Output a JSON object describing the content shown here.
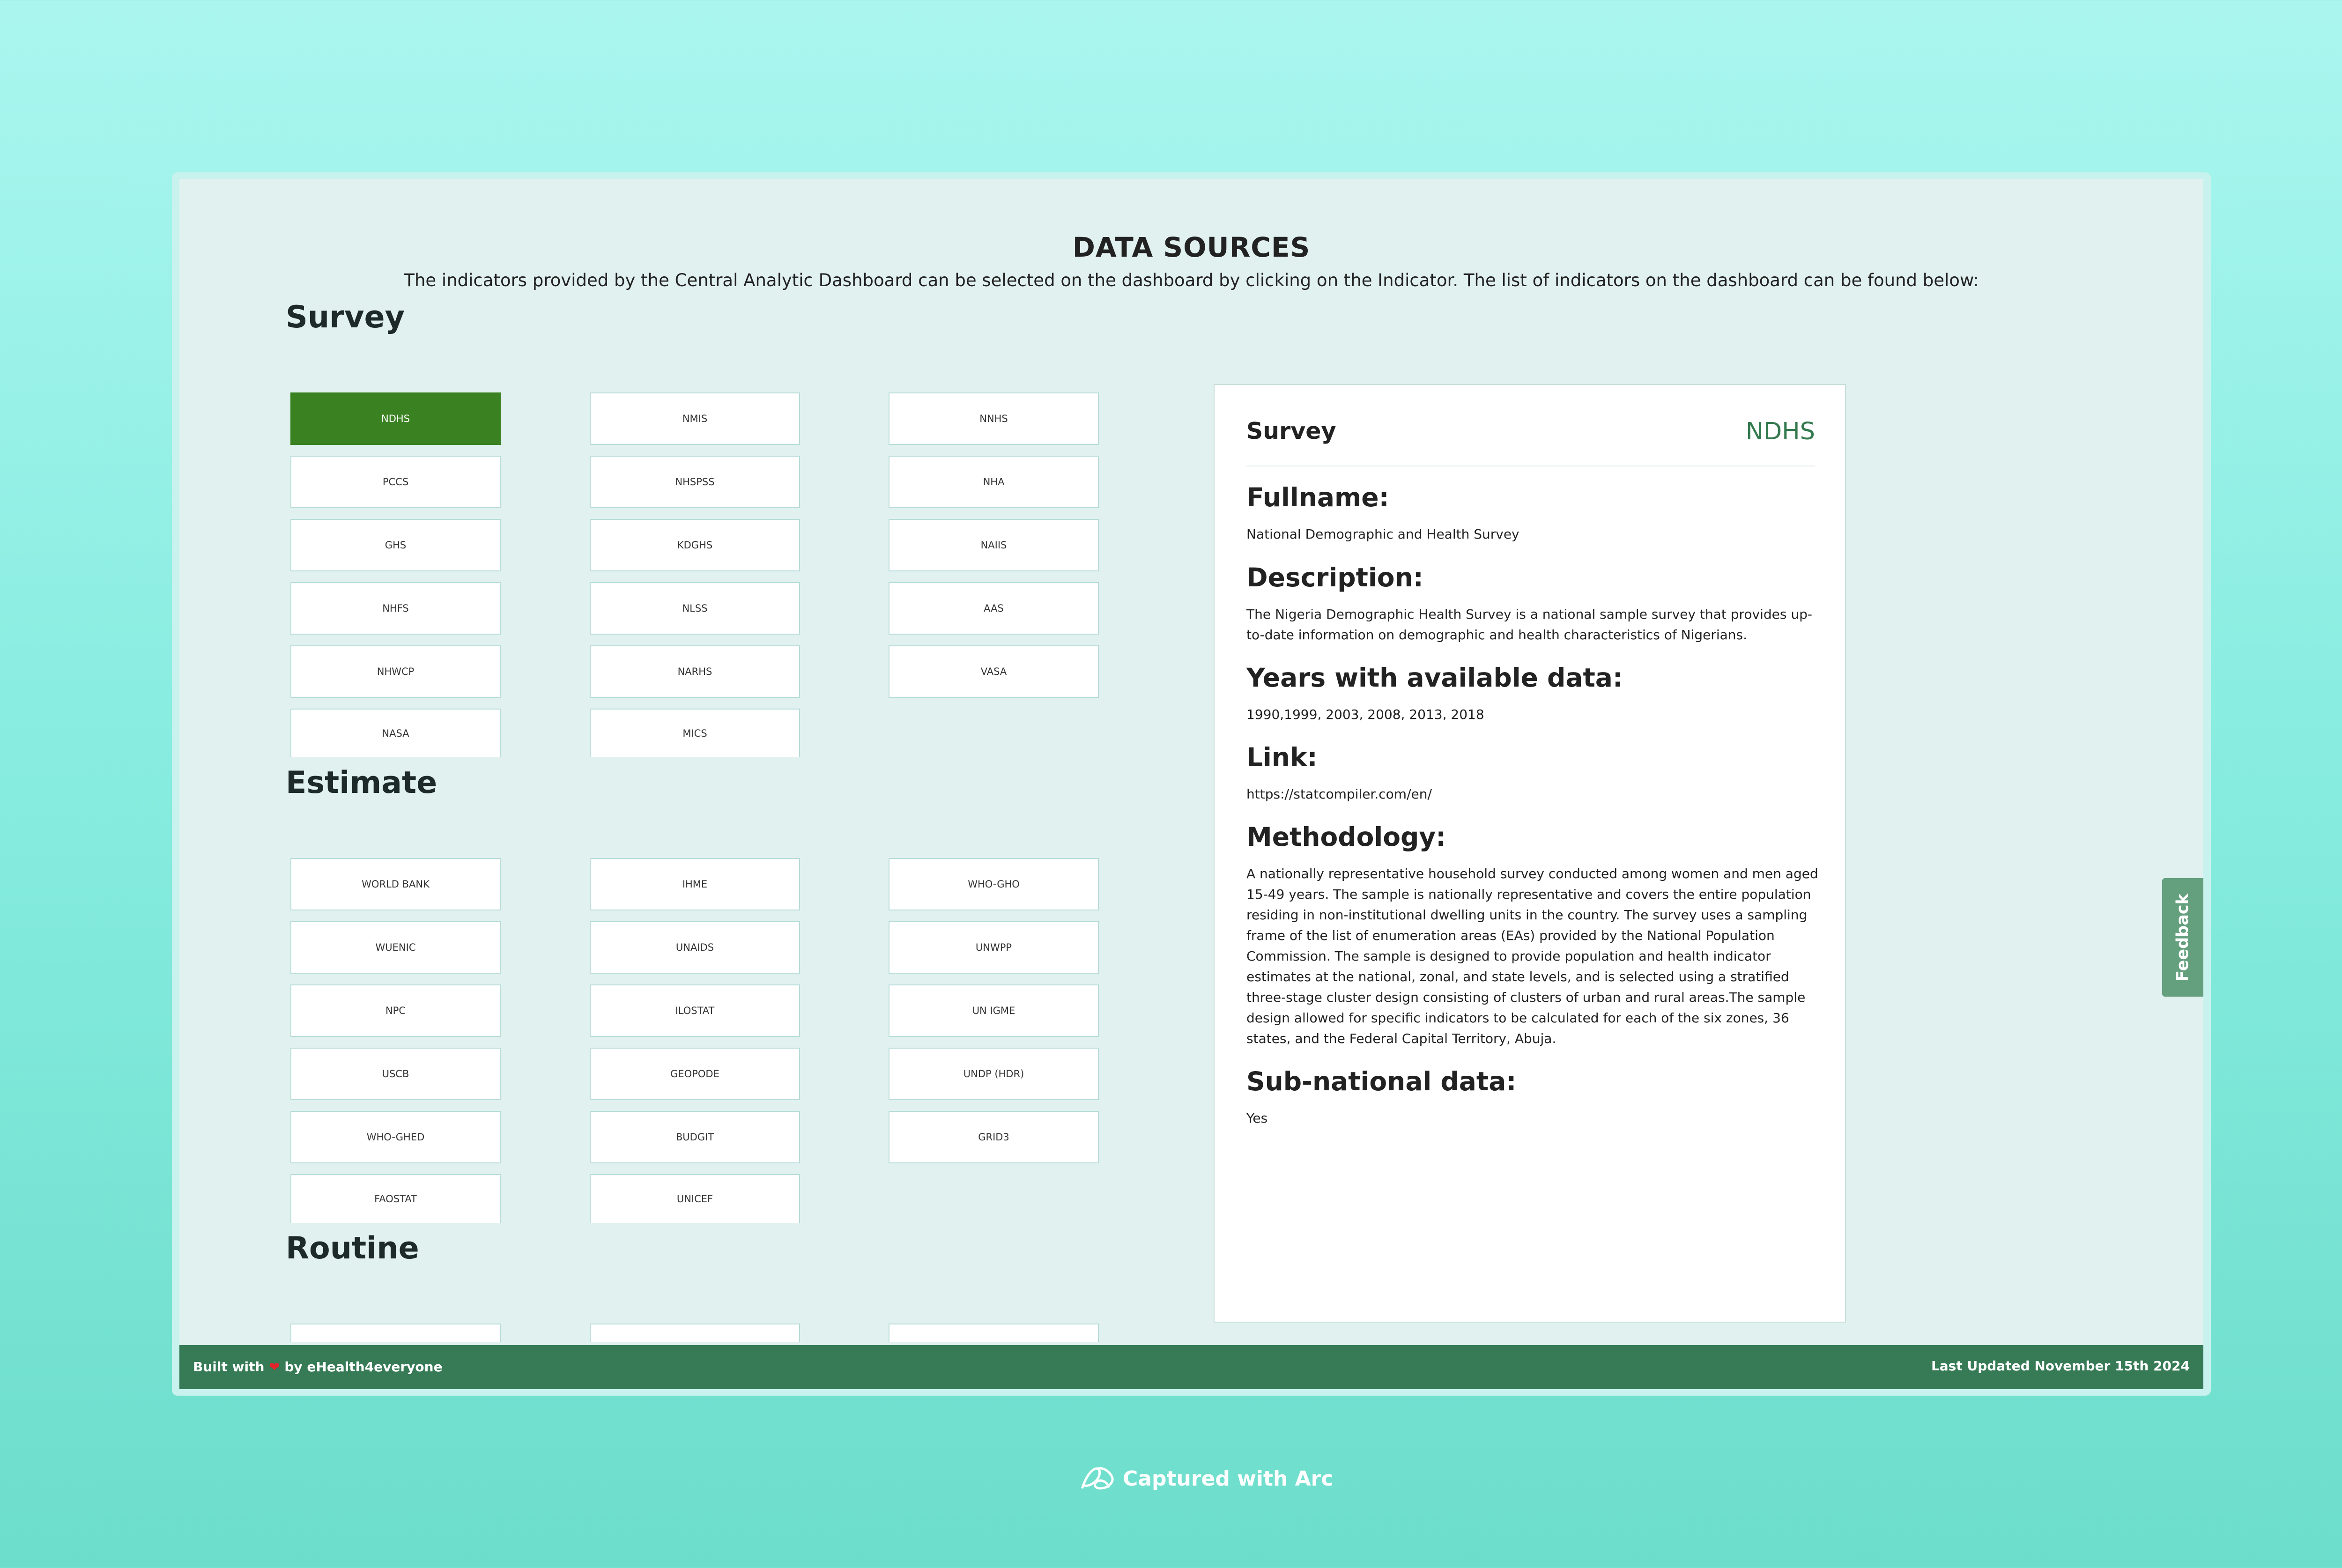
{
  "page": {
    "title": "DATA SOURCES",
    "subtitle": "The indicators provided by the Central Analytic Dashboard can be selected on the dashboard by clicking on the Indicator. The list of indicators on the dashboard can be found below:"
  },
  "sections": {
    "survey": {
      "title": "Survey",
      "items": [
        "NDHS",
        "NMIS",
        "NNHS",
        "PCCS",
        "NHSPSS",
        "NHA",
        "GHS",
        "KDGHS",
        "NAIIS",
        "NHFS",
        "NLSS",
        "AAS",
        "NHWCP",
        "NARHS",
        "VASA",
        "NASA",
        "MICS"
      ]
    },
    "estimate": {
      "title": "Estimate",
      "items": [
        "WORLD BANK",
        "IHME",
        "WHO-GHO",
        "WUENIC",
        "UNAIDS",
        "UNWPP",
        "NPC",
        "ILOSTAT",
        "UN IGME",
        "USCB",
        "GEOPODE",
        "UNDP (HDR)",
        "WHO-GHED",
        "BUDGIT",
        "GRID3",
        "FAOSTAT",
        "UNICEF"
      ]
    },
    "routine": {
      "title": "Routine"
    }
  },
  "selected": "NDHS",
  "detail": {
    "category": "Survey",
    "code": "NDHS",
    "fullname_label": "Fullname:",
    "fullname": "National Demographic and Health Survey",
    "description_label": "Description:",
    "description": "The Nigeria Demographic Health Survey is a national sample survey that provides up-to-date information on demographic and health characteristics of Nigerians.",
    "years_label": "Years with available data:",
    "years": "1990,1999, 2003, 2008, 2013, 2018",
    "link_label": "Link:",
    "link": "https://statcompiler.com/en/",
    "methodology_label": "Methodology:",
    "methodology": "A nationally representative household survey conducted among women and men aged 15-49 years. The sample is nationally representative and covers the entire population residing in non-institutional dwelling units in the country. The survey uses a sampling frame of the list of enumeration areas (EAs) provided by the National Population Commission. The sample is designed to provide population and health indicator estimates at the national, zonal, and state levels, and is selected using a stratified three-stage cluster design consisting of clusters of urban and rural areas.The sample design allowed for specific indicators to be calculated for each of the six zones, 36 states, and the Federal Capital Territory, Abuja.",
    "subnational_label": "Sub-national data:",
    "subnational": "Yes"
  },
  "footer": {
    "built_prefix": "Built with",
    "built_suffix": "by eHealth4everyone",
    "updated": "Last Updated November 15th 2024"
  },
  "feedback_label": "Feedback",
  "arc_label": "Captured with Arc",
  "colors": {
    "active": "#3a8221",
    "footer": "#367b56",
    "accent": "#33794e",
    "feedback": "#64a07e"
  }
}
